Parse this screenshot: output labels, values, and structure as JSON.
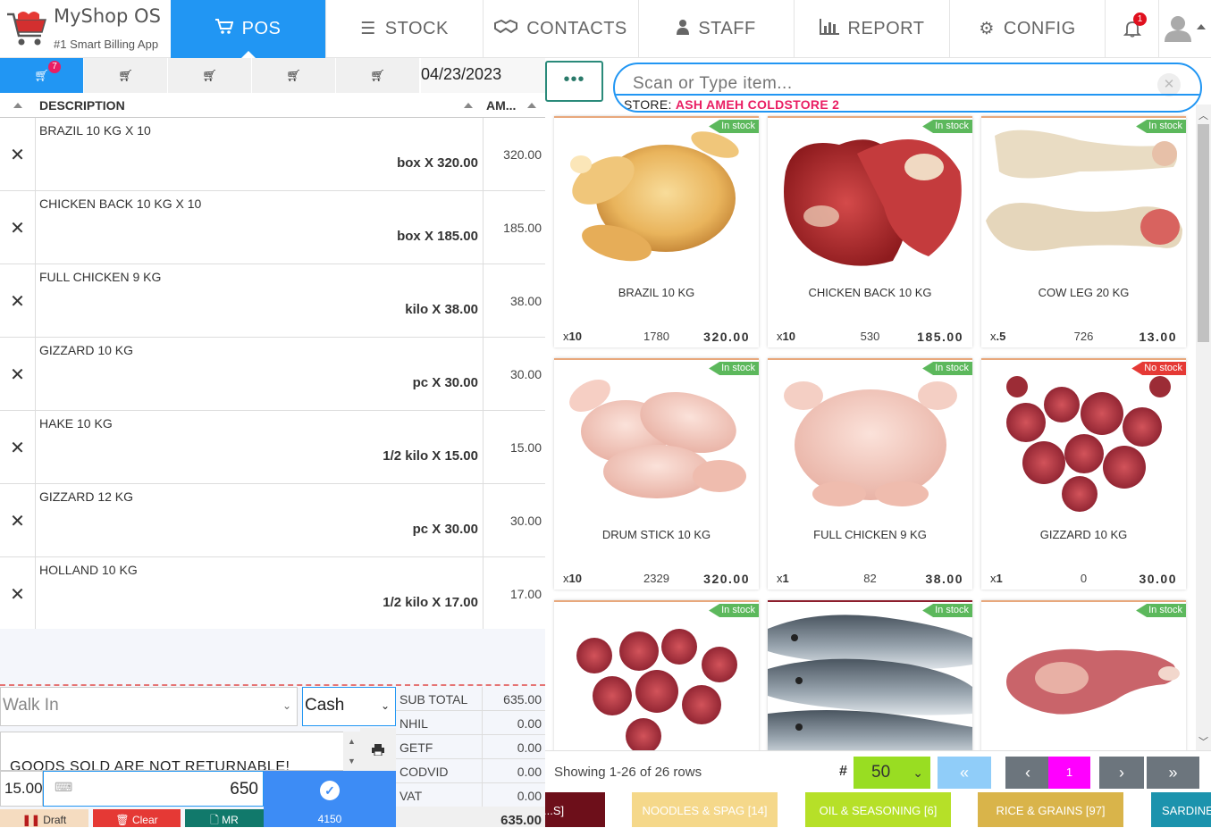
{
  "app": {
    "title": "MyShop OS",
    "tagline": "#1 Smart Billing App"
  },
  "nav": [
    {
      "label": "POS",
      "icon": "cart-icon"
    },
    {
      "label": "STOCK",
      "icon": "list-icon"
    },
    {
      "label": "CONTACTS",
      "icon": "handshake-icon"
    },
    {
      "label": "STAFF",
      "icon": "user-icon"
    },
    {
      "label": "REPORT",
      "icon": "bar-chart-icon"
    },
    {
      "label": "CONFIG",
      "icon": "gear-icon"
    }
  ],
  "notifications": {
    "count": "1"
  },
  "carts": {
    "active_count": "7"
  },
  "date": "04/23/2023",
  "table": {
    "headers": {
      "description": "DESCRIPTION",
      "amount": "AM..."
    },
    "rows": [
      {
        "name": "BRAZIL 10 KG X 10",
        "unit": "box X 320.00",
        "amount": "320.00"
      },
      {
        "name": "CHICKEN BACK 10 KG X 10",
        "unit": "box X 185.00",
        "amount": "185.00"
      },
      {
        "name": "FULL CHICKEN 9 KG",
        "unit": "kilo X 38.00",
        "amount": "38.00"
      },
      {
        "name": "GIZZARD 10 KG",
        "unit": "pc X 30.00",
        "amount": "30.00"
      },
      {
        "name": "HAKE 10 KG",
        "unit": "1/2 kilo X 15.00",
        "amount": "15.00"
      },
      {
        "name": "GIZZARD 12 KG",
        "unit": "pc X 30.00",
        "amount": "30.00"
      },
      {
        "name": "HOLLAND 10 KG",
        "unit": "1/2 kilo X 17.00",
        "amount": "17.00"
      }
    ]
  },
  "customer": {
    "value": "Walk In"
  },
  "payment_method": {
    "value": "Cash"
  },
  "notes": "GOODS SOLD ARE NOT RETURNABLE!",
  "totals": [
    {
      "label": "SUB TOTAL",
      "value": "635.00"
    },
    {
      "label": "NHIL",
      "value": "0.00"
    },
    {
      "label": "GETF",
      "value": "0.00"
    },
    {
      "label": "CODVID",
      "value": "0.00"
    },
    {
      "label": "VAT",
      "value": "0.00"
    }
  ],
  "grand_total": "635.00",
  "quantity": "15.00",
  "tendered": "650",
  "pay_button_amount": "4150",
  "actions": {
    "draft": "Draft",
    "clear": "Clear",
    "mr": "MR"
  },
  "search": {
    "placeholder": "Scan or Type item...",
    "store_label": "STORE:",
    "store_name": "ASH AMEH COLDSTORE 2"
  },
  "more_button": "•••",
  "products": [
    {
      "name": "BRAZIL 10 KG",
      "qty": "10",
      "stock": "1780",
      "price": "320.00",
      "status": "In stock",
      "image": "whole-chicken"
    },
    {
      "name": "CHICKEN BACK 10 KG",
      "qty": "10",
      "stock": "530",
      "price": "185.00",
      "status": "In stock",
      "image": "meat-chunk"
    },
    {
      "name": "COW LEG 20 KG",
      "qty": ".5",
      "stock": "726",
      "price": "13.00",
      "status": "In stock",
      "image": "cow-leg"
    },
    {
      "name": "DRUM STICK 10 KG",
      "qty": "10",
      "stock": "2329",
      "price": "320.00",
      "status": "In stock",
      "image": "drumsticks"
    },
    {
      "name": "FULL CHICKEN 9 KG",
      "qty": "1",
      "stock": "82",
      "price": "38.00",
      "status": "In stock",
      "image": "raw-chicken"
    },
    {
      "name": "GIZZARD 10 KG",
      "qty": "1",
      "stock": "0",
      "price": "30.00",
      "status": "No stock",
      "image": "gizzards"
    },
    {
      "name": "",
      "qty": "",
      "stock": "",
      "price": "",
      "status": "In stock",
      "image": "gizzards"
    },
    {
      "name": "",
      "qty": "",
      "stock": "",
      "price": "",
      "status": "In stock",
      "image": "fish"
    },
    {
      "name": "",
      "qty": "",
      "stock": "",
      "price": "",
      "status": "In stock",
      "image": "turkey-piece"
    }
  ],
  "pagination": {
    "info": "Showing 1-26 of 26 rows",
    "hash": "#",
    "page_size": "50",
    "current_page": "1",
    "first": "«",
    "prev": "‹",
    "next": "›",
    "last": "»"
  },
  "categories": [
    {
      "label": "...S]",
      "color": "#6d0f1a"
    },
    {
      "label": "NOODLES & SPAG [14]",
      "color": "#f5d88a"
    },
    {
      "label": "OIL & SEASONING [6]",
      "color": "#b6e028"
    },
    {
      "label": "RICE & GRAINS [97]",
      "color": "#d9b44a"
    },
    {
      "label": "SARDINE",
      "color": "#1c93ad"
    }
  ]
}
